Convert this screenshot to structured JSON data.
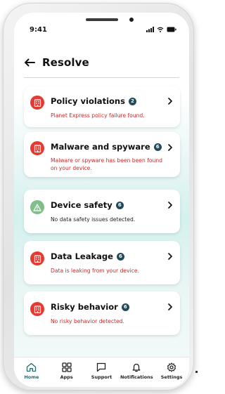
{
  "status_bar": {
    "time": "9:41"
  },
  "header": {
    "title": "Resolve"
  },
  "cards": [
    {
      "title": "Policy violations",
      "count": "2",
      "desc": "Planet Express policy failure found.",
      "tone": "red",
      "icon": "building-alert-icon"
    },
    {
      "title": "Malware and spyware",
      "count": "6",
      "desc": "Malware or spyware has been been found on your device.",
      "tone": "red",
      "icon": "building-alert-icon"
    },
    {
      "title": "Device safety",
      "count": "6",
      "desc": "No data safety issues detected.",
      "tone": "dark",
      "icon": "warning-triangle-icon"
    },
    {
      "title": "Data Leakage",
      "count": "6",
      "desc": "Data is leaking from your device.",
      "tone": "red",
      "icon": "building-alert-icon"
    },
    {
      "title": "Risky behavior",
      "count": "6",
      "desc": "No risky behavior detected.",
      "tone": "red",
      "icon": "building-alert-icon"
    }
  ],
  "tabs": [
    {
      "label": "Home",
      "icon": "home-icon"
    },
    {
      "label": "Apps",
      "icon": "grid-icon"
    },
    {
      "label": "Support",
      "icon": "chat-icon"
    },
    {
      "label": "Notifications",
      "icon": "bell-icon"
    },
    {
      "label": "Settings",
      "icon": "gear-icon"
    }
  ],
  "colors": {
    "alert_red": "#e33b32",
    "safe_green": "#7fbf8a",
    "badge_navy": "#234a5a",
    "active_teal": "#2a6a6a"
  }
}
